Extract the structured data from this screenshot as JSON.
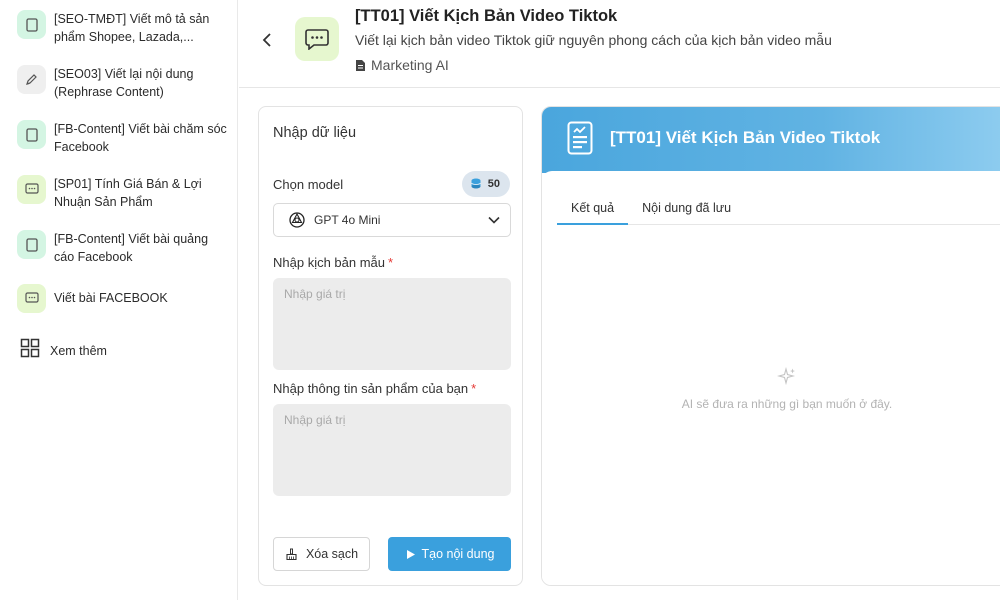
{
  "sidebar": {
    "items": [
      {
        "label": "[SEO-TMĐT] Viết mô tả sản phẩm Shopee, Lazada,...",
        "icon": "document-icon"
      },
      {
        "label": "[SEO03] Viết lại nội dung (Rephrase Content)",
        "icon": "pencil-icon"
      },
      {
        "label": "[FB-Content] Viết bài chăm sóc Facebook",
        "icon": "document-icon"
      },
      {
        "label": "[SP01] Tính Giá Bán & Lợi Nhuận Sản Phẩm",
        "icon": "chat-icon"
      },
      {
        "label": "[FB-Content] Viết bài quảng cáo Facebook",
        "icon": "document-icon"
      },
      {
        "label": "Viết bài FACEBOOK",
        "icon": "chat-icon"
      }
    ],
    "more_label": "Xem thêm"
  },
  "header": {
    "title": "[TT01] Viết Kịch Bản Video Tiktok",
    "description": "Viết lại kịch bản video Tiktok giữ nguyên phong cách của kịch bản video mẫu",
    "category": "Marketing AI"
  },
  "input_panel": {
    "title": "Nhập dữ liệu",
    "model_label": "Chọn model",
    "credits": "50",
    "model_value": "GPT 4o Mini",
    "field1_label": "Nhập kịch bản mẫu",
    "field1_placeholder": "Nhập giá trị",
    "field2_label": "Nhập thông tin sản phẩm của bạn",
    "field2_placeholder": "Nhập giá trị",
    "required_mark": "*",
    "clear_label": "Xóa sạch",
    "generate_label": "Tạo nội dung"
  },
  "result_panel": {
    "title": "[TT01] Viết Kịch Bản Video Tiktok",
    "tabs": [
      "Kết quả",
      "Nội dung đã lưu"
    ],
    "empty_text": "AI sẽ đưa ra những gì bạn muốn ở đây."
  },
  "colors": {
    "accent": "#3aa0dd",
    "icon_bg_green": "#d4f5e3",
    "icon_bg_lime": "#e6f7cf"
  }
}
